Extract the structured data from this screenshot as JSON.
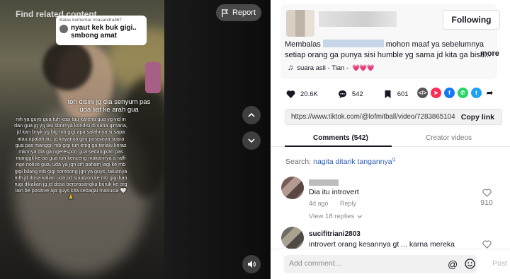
{
  "video": {
    "find_related": "Find related content",
    "report_label": "Report",
    "reply_header": "Balas komentar ricasandra467",
    "reply_text": "nyaut kek buk gigi.. smbong amat",
    "caption_1": "toh disini jg dia senyum pas uda liat ke arah gua",
    "caption_2": "nih ya guys gua tuh kasi tau karena gua yg vid in dan gua jg yg tau sbnrnya kondisi di sana gimana, jd kan bnyk yg blg mb gigi apa salahnya si sapa atau apalah itu, jd kayanya gini posisinya suara gua pas manggil mb gigi tuh emg ga terlalu keras mknnya dia ga ngerespon gua sedangkan pas manggil ke aa gua tuh kenceng makannya a raffi nge notice gua, uda ya jgn sih paham lagi ke mb gigi bilang mb gigi sombong jgn ya guys, takutnya mlh jd dosa kalian uda pd suudzon ke mb gigi kan rugi dikalian jg jd dosa berprasangka buruk ke org lain be positive aja guys kita sebagai manusia 🤍🙏"
  },
  "author": {
    "follow_label": "Following",
    "desc_prefix": "Membalas",
    "desc_rest": "mohon maaf ya sebelumnya setiap orang ga punya sisi humble yg sama jd kita ga bisa...",
    "more_label": "more",
    "music": "suara asli - Tian -",
    "music_emoji": "💗💗💗"
  },
  "stats": {
    "likes": "20.6K",
    "comments": "542",
    "saves": "601"
  },
  "share": {
    "url": "https://www.tiktok.com/@lofmitball/video/7283865104698...",
    "copy_label": "Copy link"
  },
  "tabs": {
    "comments": "Comments (542)",
    "creator": "Creator videos"
  },
  "search": {
    "prefix": "Search:",
    "term": "nagita ditarik tangannya"
  },
  "comments": [
    {
      "text": "Dia itu introvert",
      "time": "4d ago",
      "reply": "Reply",
      "replies": "View 18 replies",
      "likes": "910"
    },
    {
      "user": "sucifitriani2803",
      "text": "introvert orang kesannya gt ... karna mereka"
    }
  ],
  "composer": {
    "placeholder": "Add comment...",
    "post_label": "Post"
  },
  "colors": {
    "accent_link": "#2b5db4",
    "report_bg": "#545454",
    "share_embed": "#555555",
    "share_send": "#fe2c55",
    "share_facebook": "#1877f2",
    "share_whatsapp": "#25d366",
    "share_twitter": "#1da1f2"
  }
}
